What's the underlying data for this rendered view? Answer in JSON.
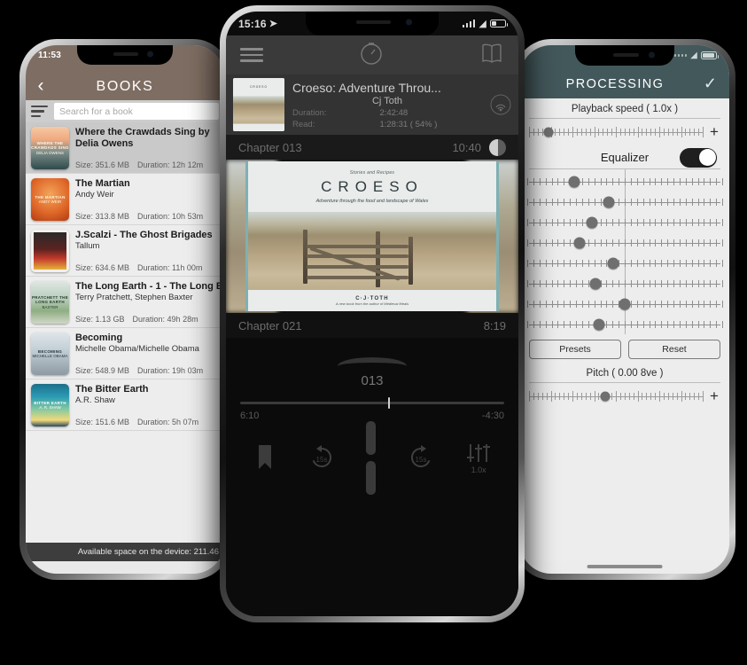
{
  "left_phone": {
    "status": {
      "time": "11:53"
    },
    "header": {
      "back_icon": "chevron-left",
      "title": "BOOKS"
    },
    "search": {
      "placeholder": "Search for a book",
      "value": ""
    },
    "books": [
      {
        "title": "Where the Crawdads Sing by Delia Owens",
        "author": "",
        "size_label": "Size: 351.6 MB",
        "duration_label": "Duration: 12h 12m",
        "cover_text": "WHERE THE CRAWDADS SING",
        "cover_author": "DELIA OWENS",
        "selected": true,
        "cover_class": "cv-crawdads"
      },
      {
        "title": "The Martian",
        "author": "Andy Weir",
        "size_label": "Size: 313.8 MB",
        "duration_label": "Duration: 10h 53m",
        "cover_text": "THE MARTIAN",
        "cover_author": "ANDY WEIR",
        "selected": false,
        "cover_class": "cv-martian"
      },
      {
        "title": "J.Scalzi - The Ghost Brigades",
        "author": "Tallum",
        "size_label": "Size: 634.6 MB",
        "duration_label": "Duration: 11h 00m",
        "cover_text": "",
        "cover_author": "",
        "selected": false,
        "cover_class": "cv-ghost"
      },
      {
        "title": "The Long Earth - 1 - The Long Earth",
        "author": "Terry Pratchett, Stephen Baxter",
        "size_label": "Size: 1.13 GB",
        "duration_label": "Duration: 49h 28m",
        "cover_text": "PRATCHETT THE LONG EARTH",
        "cover_author": "BAXTER",
        "selected": false,
        "cover_class": "cv-long"
      },
      {
        "title": "Becoming",
        "author": "Michelle Obama/Michelle Obama",
        "size_label": "Size: 548.9 MB",
        "duration_label": "Duration: 19h 03m",
        "cover_text": "BECOMING",
        "cover_author": "MICHELLE OBAMA",
        "selected": false,
        "cover_class": "cv-becoming"
      },
      {
        "title": "The Bitter Earth",
        "author": "A.R. Shaw",
        "size_label": "Size: 151.6 MB",
        "duration_label": "Duration: 5h 07m",
        "cover_text": "BITTER EARTH",
        "cover_author": "A. R. SHAW",
        "selected": false,
        "cover_class": "cv-bitter"
      }
    ],
    "footer": {
      "available_space": "Available space on the device: 211.46"
    }
  },
  "center_phone": {
    "status": {
      "time": "15:16",
      "location_icon": "location-arrow"
    },
    "toolbar": {
      "menu_icon": "hamburger-menu-icon",
      "timer_icon": "sleep-timer-icon",
      "book_icon": "open-book-icon"
    },
    "now_playing": {
      "title": "Croeso: Adventure Throu...",
      "author": "Cj Toth",
      "duration_key": "Duration:",
      "duration_value": "2:42:48",
      "read_key": "Read:",
      "read_value": "1:28:31 ( 54% )",
      "airplay_icon": "airplay-icon"
    },
    "chapter_top": {
      "label": "Chapter 013",
      "time": "10:40"
    },
    "chapter_bottom": {
      "label": "Chapter 021",
      "time": "8:19"
    },
    "cover": {
      "tagline": "Stories and Recipes",
      "title": "CROESO",
      "subtitle": "Adventure through the food and landscape of Wales",
      "author": "C·J·TOTH",
      "footnote": "A new book from the author of Medieval Meals"
    },
    "player": {
      "chapter_number": "013",
      "elapsed": "6:10",
      "remaining": "-4:30",
      "progress_percent": 56,
      "bookmark_icon": "bookmark-icon",
      "rewind_label": "15s",
      "rewind_icon": "rewind-15-icon",
      "pause_icon": "pause-icon",
      "forward_label": "15s",
      "forward_icon": "forward-15-icon",
      "equalizer_icon": "equalizer-sliders-icon",
      "speed_label": "1.0x"
    }
  },
  "right_phone": {
    "status": {
      "dots": 5
    },
    "header": {
      "title": "PROCESSING",
      "confirm_icon": "checkmark-icon"
    },
    "playback_speed": {
      "label": "Playback speed ( 1.0x )",
      "knob_percent": 11,
      "plus_label": "+"
    },
    "equalizer": {
      "label": "Equalizer",
      "enabled": true
    },
    "eq_bands": [
      {
        "knob_percent": 24
      },
      {
        "knob_percent": 42
      },
      {
        "knob_percent": 33
      },
      {
        "knob_percent": 27
      },
      {
        "knob_percent": 44
      },
      {
        "knob_percent": 35
      },
      {
        "knob_percent": 50
      },
      {
        "knob_percent": 37
      }
    ],
    "buttons": {
      "presets": "Presets",
      "reset": "Reset"
    },
    "pitch": {
      "label": "Pitch ( 0.00 8ve )",
      "knob_percent": 44,
      "plus_label": "+"
    }
  }
}
